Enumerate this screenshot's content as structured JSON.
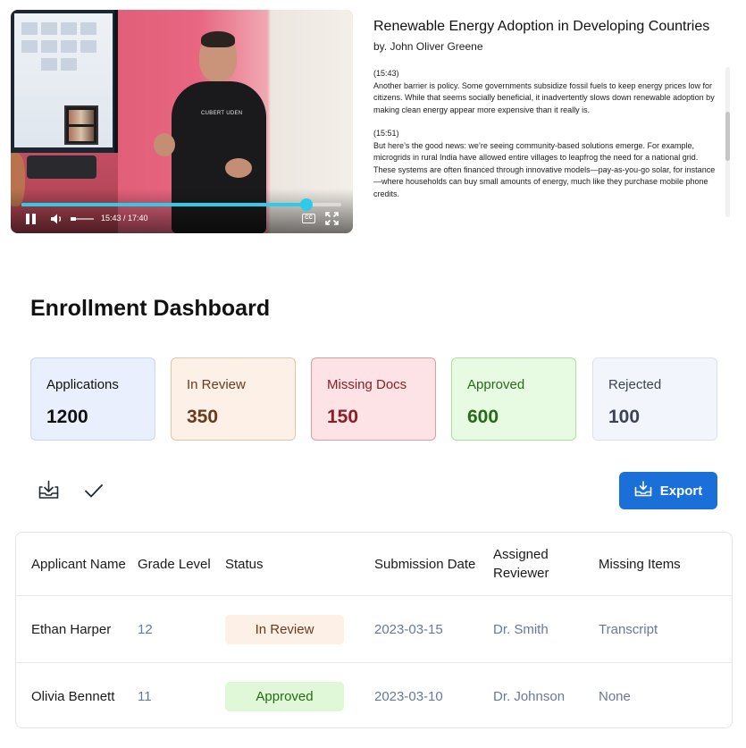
{
  "video": {
    "time_label": "15:43 / 17:40",
    "progress_fraction": 0.89,
    "shirt_text": "CUBERT UDEN"
  },
  "talk": {
    "title": "Renewable Energy Adoption in Developing Countries",
    "author": "by. John Oliver Greene"
  },
  "transcript": [
    {
      "timestamp": "(15:43)",
      "text": "Another barrier is policy. Some governments subsidize fossil fuels to keep energy prices low for citizens. While that seems socially beneficial, it inadvertently slows down renewable adoption by making clean energy appear more expensive than it really is."
    },
    {
      "timestamp": "(15:51)",
      "text": "But here’s the good news: we’re seeing community-based solutions emerge. For example, microgrids in rural India have allowed entire villages to leapfrog the need for a national grid. These systems are often financed through innovative models—pay-as-you-go solar, for instance—where households can buy small amounts of energy, much like they purchase mobile phone credits."
    }
  ],
  "dashboard": {
    "title": "Enrollment Dashboard",
    "export_label": "Export"
  },
  "stats": [
    {
      "label": "Applications",
      "value": "1200"
    },
    {
      "label": "In Review",
      "value": "350"
    },
    {
      "label": "Missing Docs",
      "value": "150"
    },
    {
      "label": "Approved",
      "value": "600"
    },
    {
      "label": "Rejected",
      "value": "100"
    }
  ],
  "table": {
    "headers": [
      "Applicant Name",
      "Grade Level",
      "Status",
      "Submission Date",
      "Assigned Reviewer",
      "Missing Items"
    ],
    "rows": [
      {
        "name": "Ethan Harper",
        "grade": "12",
        "status": "In Review",
        "date": "2023-03-15",
        "reviewer": "Dr. Smith",
        "missing": "Transcript"
      },
      {
        "name": "Olivia Bennett",
        "grade": "11",
        "status": "Approved",
        "date": "2023-03-10",
        "reviewer": "Dr. Johnson",
        "missing": "None"
      }
    ]
  },
  "colors": {
    "accent": "#1a6fd8",
    "progress": "#2ecbe8",
    "in_review": "#fdf0e6",
    "approved": "#e0f8d8",
    "missing_docs": "#fde3e6"
  },
  "icons": [
    "pause-icon",
    "volume-icon",
    "closed-captions-icon",
    "fullscreen-icon",
    "download-icon",
    "check-icon",
    "export-icon"
  ]
}
